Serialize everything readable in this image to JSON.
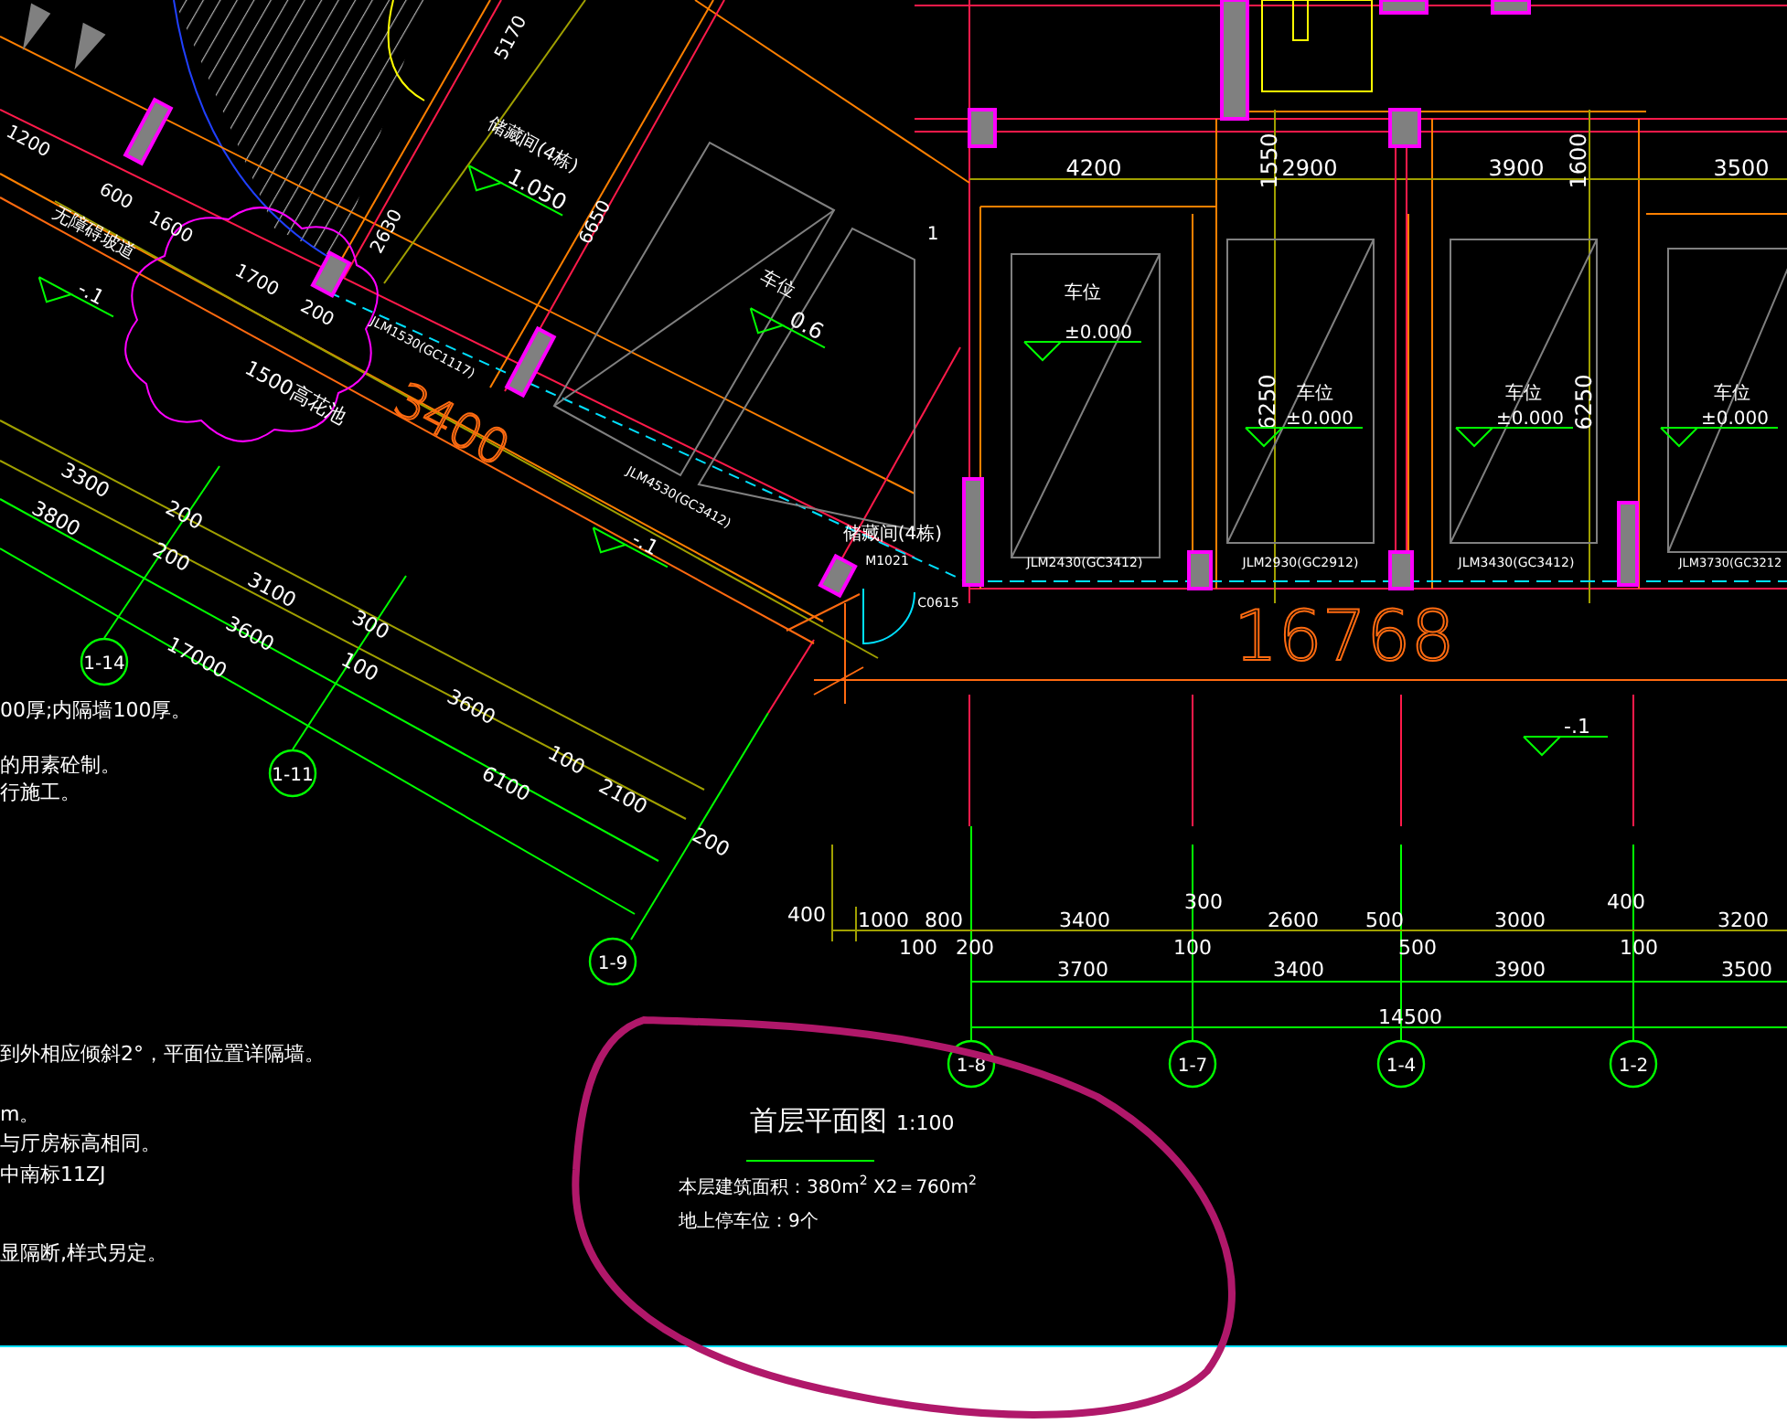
{
  "texts": [
    {
      "kind": "dimension",
      "text": "1200"
    },
    {
      "kind": "dimension",
      "text": "600"
    },
    {
      "kind": "dimension",
      "text": "1600"
    },
    {
      "kind": "dimension",
      "text": "1700"
    },
    {
      "kind": "dimension",
      "text": "200"
    },
    {
      "kind": "dimension",
      "text": "5170"
    },
    {
      "kind": "dimension",
      "text": "2630"
    },
    {
      "kind": "dimension",
      "text": "6650"
    },
    {
      "kind": "dimension",
      "text": "3300"
    },
    {
      "kind": "dimension",
      "text": "3800"
    },
    {
      "kind": "dimension",
      "text": "200"
    },
    {
      "kind": "dimension",
      "text": "200"
    },
    {
      "kind": "dimension",
      "text": "3100"
    },
    {
      "kind": "dimension",
      "text": "3600"
    },
    {
      "kind": "dimension",
      "text": "17000"
    },
    {
      "kind": "dimension",
      "text": "300"
    },
    {
      "kind": "dimension",
      "text": "100"
    },
    {
      "kind": "dimension",
      "text": "3600"
    },
    {
      "kind": "dimension",
      "text": "100"
    },
    {
      "kind": "dimension",
      "text": "6100"
    },
    {
      "kind": "dimension",
      "text": "2100"
    },
    {
      "kind": "dimension",
      "text": "200"
    },
    {
      "kind": "dimension",
      "text": "4200"
    },
    {
      "kind": "dimension",
      "text": "2900"
    },
    {
      "kind": "dimension",
      "text": "3900"
    },
    {
      "kind": "dimension",
      "text": "3500"
    },
    {
      "kind": "dimension",
      "text": "1550"
    },
    {
      "kind": "dimension",
      "text": "1600"
    },
    {
      "kind": "dimension",
      "text": "6250"
    },
    {
      "kind": "dimension",
      "text": "6250"
    },
    {
      "kind": "dimension",
      "text": "400"
    },
    {
      "kind": "dimension",
      "text": "1000"
    },
    {
      "kind": "dimension",
      "text": "800"
    },
    {
      "kind": "dimension",
      "text": "3400"
    },
    {
      "kind": "dimension",
      "text": "300"
    },
    {
      "kind": "dimension",
      "text": "2600"
    },
    {
      "kind": "dimension",
      "text": "500"
    },
    {
      "kind": "dimension",
      "text": "3000"
    },
    {
      "kind": "dimension",
      "text": "400"
    },
    {
      "kind": "dimension",
      "text": "3200"
    },
    {
      "kind": "dimension",
      "text": "100"
    },
    {
      "kind": "dimension",
      "text": "200"
    },
    {
      "kind": "dimension",
      "text": "100"
    },
    {
      "kind": "dimension",
      "text": "500"
    },
    {
      "kind": "dimension",
      "text": "100"
    },
    {
      "kind": "dimension",
      "text": "3700"
    },
    {
      "kind": "dimension",
      "text": "3400"
    },
    {
      "kind": "dimension",
      "text": "3900"
    },
    {
      "kind": "dimension",
      "text": "3500"
    },
    {
      "kind": "dimension",
      "text": "14500"
    },
    {
      "kind": "elevation",
      "text": "-.1"
    },
    {
      "kind": "elevation",
      "text": "1.050"
    },
    {
      "kind": "elevation",
      "text": "0.6"
    },
    {
      "kind": "elevation",
      "text": "-.1"
    },
    {
      "kind": "elevation",
      "text": "±0.000"
    },
    {
      "kind": "elevation",
      "text": "±0.000"
    },
    {
      "kind": "elevation",
      "text": "±0.000"
    },
    {
      "kind": "elevation",
      "text": "±0.000"
    },
    {
      "kind": "elevation",
      "text": "-.1"
    },
    {
      "kind": "label",
      "text": "储藏间(4栋)"
    },
    {
      "kind": "label",
      "text": "车位"
    },
    {
      "kind": "label",
      "text": "车位"
    },
    {
      "kind": "label",
      "text": "车位"
    },
    {
      "kind": "label",
      "text": "车位"
    },
    {
      "kind": "label",
      "text": "车位"
    },
    {
      "kind": "label",
      "text": "无障碍坡道"
    },
    {
      "kind": "code",
      "text": "1"
    },
    {
      "kind": "label",
      "text": "1500高花池"
    },
    {
      "kind": "label",
      "text": "储藏间(4栋)"
    },
    {
      "kind": "code",
      "text": "JLM1530(GC1117)"
    },
    {
      "kind": "code",
      "text": "JLM4530(GC3412)"
    },
    {
      "kind": "code",
      "text": "M1021"
    },
    {
      "kind": "code",
      "text": "JLM2430(GC3412)"
    },
    {
      "kind": "code",
      "text": "JLM2930(GC2912)"
    },
    {
      "kind": "code",
      "text": "JLM3430(GC3412)"
    },
    {
      "kind": "code",
      "text": "JLM3730(GC3212"
    },
    {
      "kind": "code",
      "text": "C0615"
    },
    {
      "kind": "overlay",
      "text": "3400"
    },
    {
      "kind": "overlay",
      "text": "16768"
    },
    {
      "kind": "axis",
      "text": "1-14"
    },
    {
      "kind": "axis",
      "text": "1-11"
    },
    {
      "kind": "axis",
      "text": "1-9"
    },
    {
      "kind": "axis",
      "text": "1-8"
    },
    {
      "kind": "axis",
      "text": "1-7"
    },
    {
      "kind": "axis",
      "text": "1-4"
    },
    {
      "kind": "axis",
      "text": "1-2"
    }
  ],
  "notes": [
    "00厚;内隔墙100厚。",
    "的用素砼制。",
    "行施工。",
    "到外相应倾斜2°，平面位置详隔墙。",
    "m。",
    "与厅房标高相同。",
    "中南标11ZJ",
    "显隔断,样式另定。"
  ],
  "title_block": {
    "title": "首层平面图",
    "scale": "1:100",
    "lines": [
      "本层建筑面积：380m$^{2}$ X2＝760m$^{2}$",
      "地上停车位：9个"
    ]
  }
}
